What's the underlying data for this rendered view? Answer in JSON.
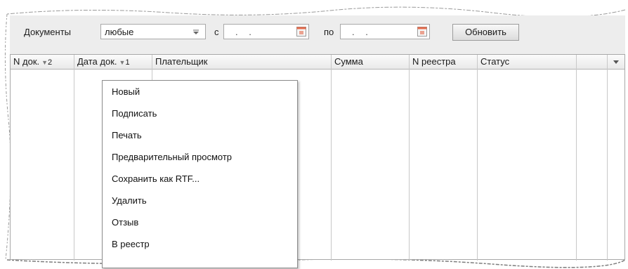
{
  "filter": {
    "documents_label": "Документы",
    "documents_value": "любые",
    "from_label": "с",
    "from_value": ". .",
    "to_label": "по",
    "to_value": ". .",
    "refresh_label": "Обновить"
  },
  "table": {
    "columns": [
      {
        "label": "N док.",
        "sort_index": "2"
      },
      {
        "label": "Дата док.",
        "sort_index": "1"
      },
      {
        "label": "Плательщик"
      },
      {
        "label": "Сумма"
      },
      {
        "label": "N реестра"
      },
      {
        "label": "Статус"
      }
    ]
  },
  "context_menu": {
    "items": [
      "Новый",
      "Подписать",
      "Печать",
      "Предварительный просмотр",
      "Сохранить как RTF...",
      "Удалить",
      "Отзыв",
      "В реестр"
    ]
  },
  "colors": {
    "background": "#ededed",
    "accent_calendar": "#e46b4c"
  }
}
